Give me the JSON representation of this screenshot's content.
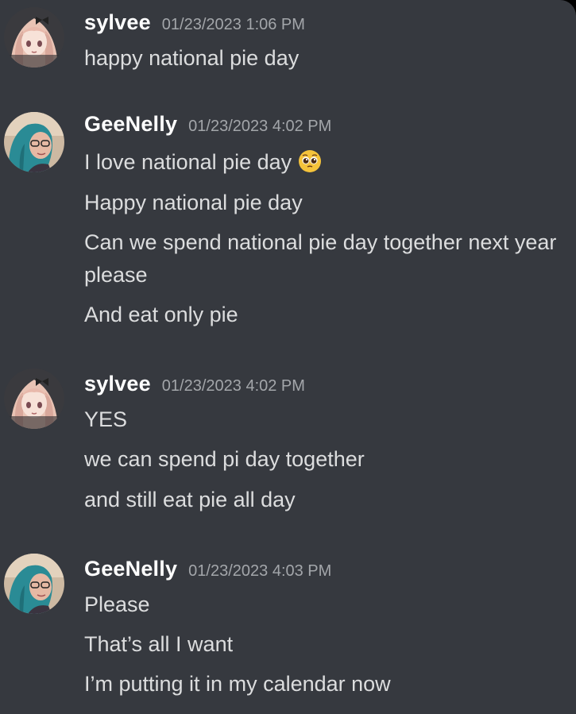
{
  "messages": [
    {
      "username": "sylvee",
      "timestamp": "01/23/2023 1:06 PM",
      "avatar": "anime-girl-avatar",
      "lines": [
        "happy national pie day"
      ]
    },
    {
      "username": "GeeNelly",
      "timestamp": "01/23/2023 4:02 PM",
      "avatar": "blue-hair-photo-avatar",
      "lines": [
        "I love national pie day",
        "Happy national pie day",
        "Can we spend national pie day together next year please",
        "And eat only pie"
      ],
      "emoji": "pleading-face-emoji"
    },
    {
      "username": "sylvee",
      "timestamp": "01/23/2023 4:02 PM",
      "avatar": "anime-girl-avatar",
      "lines": [
        "YES",
        "we can spend pi day together",
        "and still eat pie all day"
      ]
    },
    {
      "username": "GeeNelly",
      "timestamp": "01/23/2023 4:03 PM",
      "avatar": "blue-hair-photo-avatar",
      "lines": [
        "Please",
        "That’s all I want",
        "I’m putting it in my calendar now"
      ]
    }
  ],
  "colors": {
    "background": "#36393f",
    "username": "#ffffff",
    "timestamp": "#a3a6aa",
    "message_text": "#dcddde"
  }
}
